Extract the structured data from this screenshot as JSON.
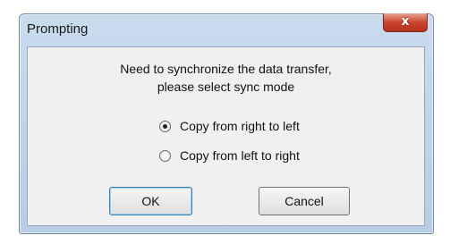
{
  "window": {
    "title": "Prompting",
    "close_label": "x"
  },
  "message": {
    "line1": "Need to synchronize the data transfer,",
    "line2": "please select sync mode"
  },
  "options": [
    {
      "label": "Copy from right to left",
      "selected": true
    },
    {
      "label": "Copy from left to right",
      "selected": false
    }
  ],
  "buttons": {
    "ok": "OK",
    "cancel": "Cancel"
  }
}
